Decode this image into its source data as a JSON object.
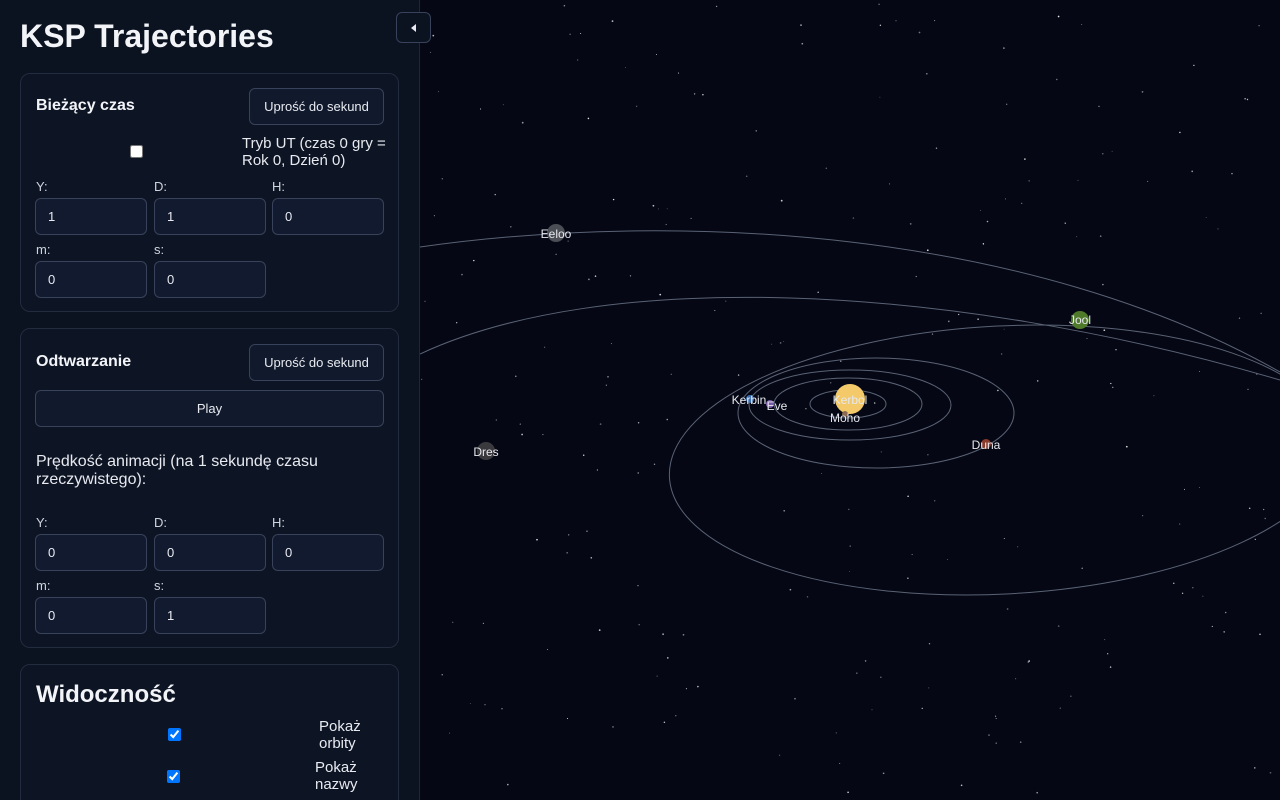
{
  "app": {
    "title": "KSP Trajectories"
  },
  "current_time": {
    "title": "Bieżący czas",
    "simplify_label": "Uprość do sekund",
    "ut_mode_label": "Tryb UT (czas 0 gry = Rok 0, Dzień 0)",
    "ut_mode_checked": false,
    "fields": [
      {
        "label": "Y:",
        "value": "1"
      },
      {
        "label": "D:",
        "value": "1"
      },
      {
        "label": "H:",
        "value": "0"
      },
      {
        "label": "m:",
        "value": "0"
      },
      {
        "label": "s:",
        "value": "0"
      }
    ]
  },
  "playback": {
    "title": "Odtwarzanie",
    "simplify_label": "Uprość do sekund",
    "play_label": "Play",
    "speed_label": "Prędkość animacji (na 1 sekundę czasu rzeczywistego):",
    "fields": [
      {
        "label": "Y:",
        "value": "0"
      },
      {
        "label": "D:",
        "value": "0"
      },
      {
        "label": "H:",
        "value": "0"
      },
      {
        "label": "m:",
        "value": "0"
      },
      {
        "label": "s:",
        "value": "1"
      }
    ]
  },
  "visibility": {
    "title": "Widoczność",
    "show_orbits_label": "Pokaż orbity",
    "show_orbits_checked": true,
    "show_names_label": "Pokaż nazwy",
    "show_names_checked": true
  },
  "map": {
    "bodies": [
      "Kerbol",
      "Moho",
      "Eve",
      "Kerbin",
      "Duna",
      "Dres",
      "Jool",
      "Eeloo"
    ],
    "colors": {
      "orbit": "#5a6275",
      "star": "#ffffff",
      "sun": "#f4c96a",
      "background": "#050814"
    }
  },
  "icons": {
    "collapse": "caret-left-icon"
  }
}
